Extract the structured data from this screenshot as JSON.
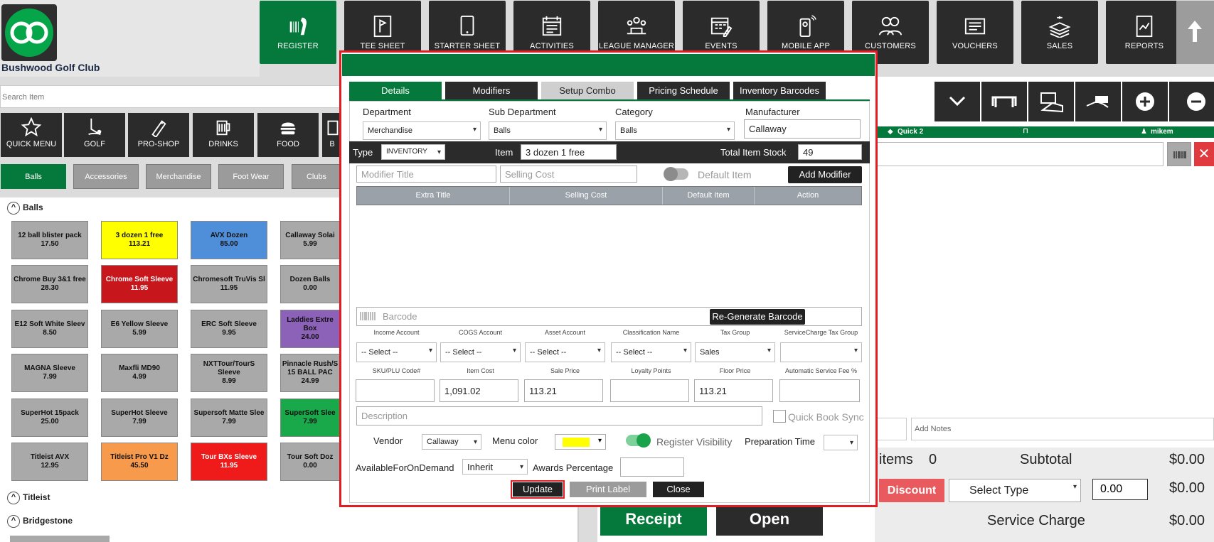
{
  "club_name": "Bushwood Golf Club",
  "nav": [
    {
      "label": "REGISTER",
      "icon": "barcode-scanner-icon"
    },
    {
      "label": "TEE SHEET",
      "icon": "flag-icon"
    },
    {
      "label": "STARTER SHEET",
      "icon": "tablet-icon"
    },
    {
      "label": "ACTIVITIES",
      "icon": "calendar-icon"
    },
    {
      "label": "LEAGUE MANAGER",
      "icon": "group-icon"
    },
    {
      "label": "EVENTS",
      "icon": "calendar-edit-icon"
    },
    {
      "label": "MOBILE APP",
      "icon": "mobile-icon"
    },
    {
      "label": "CUSTOMERS",
      "icon": "customers-icon"
    },
    {
      "label": "VOUCHERS",
      "icon": "voucher-icon"
    },
    {
      "label": "SALES",
      "icon": "money-icon"
    },
    {
      "label": "REPORTS",
      "icon": "report-icon"
    }
  ],
  "search_placeholder": "Search Item",
  "categories": [
    {
      "label": "QUICK MENU",
      "icon": "star-icon"
    },
    {
      "label": "GOLF",
      "icon": "golf-icon"
    },
    {
      "label": "PRO-SHOP",
      "icon": "tag-icon"
    },
    {
      "label": "DRINKS",
      "icon": "beer-icon"
    },
    {
      "label": "FOOD",
      "icon": "burger-icon"
    },
    {
      "label": "B",
      "icon": "bev-icon"
    }
  ],
  "subtabs": [
    "Balls",
    "Accessories",
    "Merchandise",
    "Foot Wear",
    "Clubs"
  ],
  "sections": [
    "Balls",
    "Titleist",
    "Bridgestone"
  ],
  "tiles": [
    {
      "name": "12 ball blister pack",
      "price": "17.50",
      "color": "#a9a9a9"
    },
    {
      "name": "3 dozen 1 free",
      "price": "113.21",
      "color": "#ffff00"
    },
    {
      "name": "AVX Dozen",
      "price": "85.00",
      "color": "#4f8fd9"
    },
    {
      "name": "Callaway Solai",
      "price": "5.99",
      "color": "#a9a9a9"
    },
    {
      "name": "Chrome Buy 3&1 free",
      "price": "28.30",
      "color": "#a9a9a9"
    },
    {
      "name": "Chrome Soft Sleeve",
      "price": "11.95",
      "color": "#c8161d"
    },
    {
      "name": "Chromesoft TruVis Sl",
      "price": "11.95",
      "color": "#a9a9a9"
    },
    {
      "name": "Dozen Balls",
      "price": "0.00",
      "color": "#a9a9a9"
    },
    {
      "name": "E12 Soft White Sleev",
      "price": "8.50",
      "color": "#a9a9a9"
    },
    {
      "name": "E6 Yellow Sleeve",
      "price": "5.99",
      "color": "#a9a9a9"
    },
    {
      "name": "ERC Soft Sleeve",
      "price": "9.95",
      "color": "#a9a9a9"
    },
    {
      "name": "Laddies Extre Box",
      "price": "24.00",
      "color": "#8c61b8"
    },
    {
      "name": "MAGNA Sleeve",
      "price": "7.99",
      "color": "#a9a9a9"
    },
    {
      "name": "Maxfli MD90",
      "price": "4.99",
      "color": "#a9a9a9"
    },
    {
      "name": "NXTTour/TourS Sleeve",
      "price": "8.99",
      "color": "#a9a9a9"
    },
    {
      "name": "Pinnacle Rush/S 15 BALL PAC",
      "price": "24.99",
      "color": "#a9a9a9"
    },
    {
      "name": "SuperHot 15pack",
      "price": "25.00",
      "color": "#a9a9a9"
    },
    {
      "name": "SuperHot Sleeve",
      "price": "7.99",
      "color": "#a9a9a9"
    },
    {
      "name": "Supersoft Matte Slee",
      "price": "7.99",
      "color": "#a9a9a9"
    },
    {
      "name": "SuperSoft Slee",
      "price": "7.99",
      "color": "#19a84a"
    },
    {
      "name": "Titleist AVX",
      "price": "12.95",
      "color": "#a9a9a9"
    },
    {
      "name": "Titleist Pro V1 Dz",
      "price": "45.50",
      "color": "#f79a4c"
    },
    {
      "name": "Tour BXs Sleeve",
      "price": "11.95",
      "color": "#ef1b1b"
    },
    {
      "name": "Tour Soft Doz",
      "price": "0.00",
      "color": "#a9a9a9"
    }
  ],
  "right": {
    "quick2": "Quick 2",
    "user": "mikem",
    "notes_placeholder": "Add Notes",
    "items_label": "items",
    "items_count": "0",
    "subtotal_label": "Subtotal",
    "subtotal": "$0.00",
    "discount_label": "Discount",
    "select_type": "Select Type",
    "discount_value": "0.00",
    "discount_total": "$0.00",
    "service_label": "Service Charge",
    "service_total": "$0.00",
    "receipt": "Receipt",
    "open": "Open"
  },
  "modal": {
    "tabs": [
      "Details",
      "Modifiers",
      "Setup Combo",
      "Pricing Schedule",
      "Inventory Barcodes"
    ],
    "department_label": "Department",
    "department": "Merchandise",
    "subdept_label": "Sub Department",
    "subdept": "Balls",
    "category_label": "Category",
    "category": "Balls",
    "manufacturer_label": "Manufacturer",
    "manufacturer": "Callaway",
    "type_label": "Type",
    "type": "INVENTORY",
    "item_label": "Item",
    "item": "3 dozen 1 free",
    "stock_label": "Total Item Stock",
    "stock": "49",
    "modifier_title_ph": "Modifier Title",
    "selling_cost_ph": "Selling Cost",
    "default_item": "Default Item",
    "add_modifier": "Add Modifier",
    "grid_cols": [
      "Extra Title",
      "Selling Cost",
      "Default Item",
      "Action"
    ],
    "barcode_ph": "Barcode",
    "regen_barcode": "Re-Generate Barcode",
    "row1_labels": [
      "Income Account",
      "COGS Account",
      "Asset Account",
      "Classification Name",
      "Tax Group",
      "ServiceCharge Tax Group"
    ],
    "row1_values": [
      "-- Select --",
      "-- Select --",
      "-- Select --",
      "-- Select --",
      "Sales",
      ""
    ],
    "row2_labels": [
      "SKU/PLU Code#",
      "Item Cost",
      "Sale Price",
      "Loyalty Points",
      "Floor Price",
      "Automatic Service Fee %"
    ],
    "row2_values": [
      "",
      "1,091.02",
      "113.21",
      "",
      "113.21",
      ""
    ],
    "description_ph": "Description",
    "quick_book_sync": "Quick Book Sync",
    "vendor_label": "Vendor",
    "vendor": "Callaway",
    "menu_color_label": "Menu color",
    "menu_color": "#ffff00",
    "register_visibility": "Register Visibility",
    "prep_time_label": "Preparation Time",
    "available_label": "AvailableForOnDemand",
    "available": "Inherit",
    "awards_label": "Awards Percentage",
    "update": "Update",
    "print_label": "Print Label",
    "close": "Close"
  }
}
